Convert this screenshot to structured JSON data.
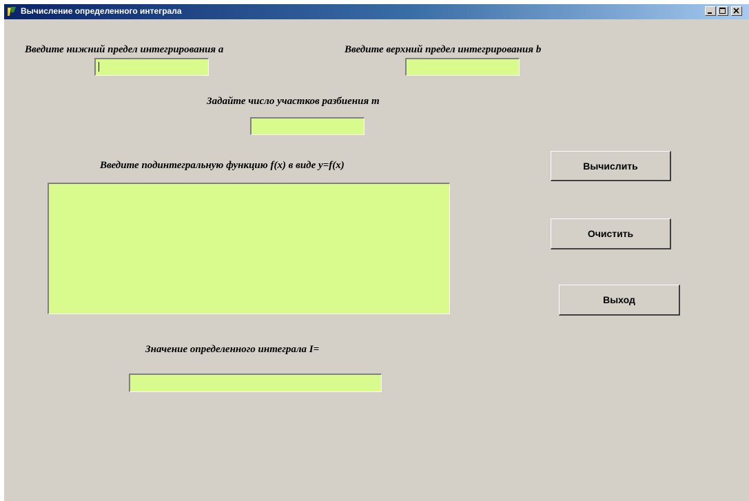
{
  "window": {
    "title": "Вычисление определенного интеграла",
    "controls": {
      "minimize": "minimize-icon",
      "maximize": "maximize-icon",
      "close": "close-icon"
    }
  },
  "form": {
    "lower_limit_label": "Введите нижний предел интегрирования  a",
    "lower_limit_value": "",
    "upper_limit_label": "Введите верхний предел интегрирования  b",
    "upper_limit_value": "",
    "partitions_label": "Задайте число участков разбиения  m",
    "partitions_value": "",
    "function_label": "Введите подинтегральную функцию f(x) в виде  y=f(x)",
    "function_value": "",
    "result_label": "Значение определенного интеграла  I=",
    "result_value": ""
  },
  "buttons": {
    "calculate": "Вычислить",
    "clear": "Очистить",
    "exit": "Выход"
  },
  "colors": {
    "window_bg": "#d4d0c8",
    "field_bg": "#d9fa8c",
    "titlebar_start": "#0a246a",
    "titlebar_end": "#a6caf0"
  }
}
